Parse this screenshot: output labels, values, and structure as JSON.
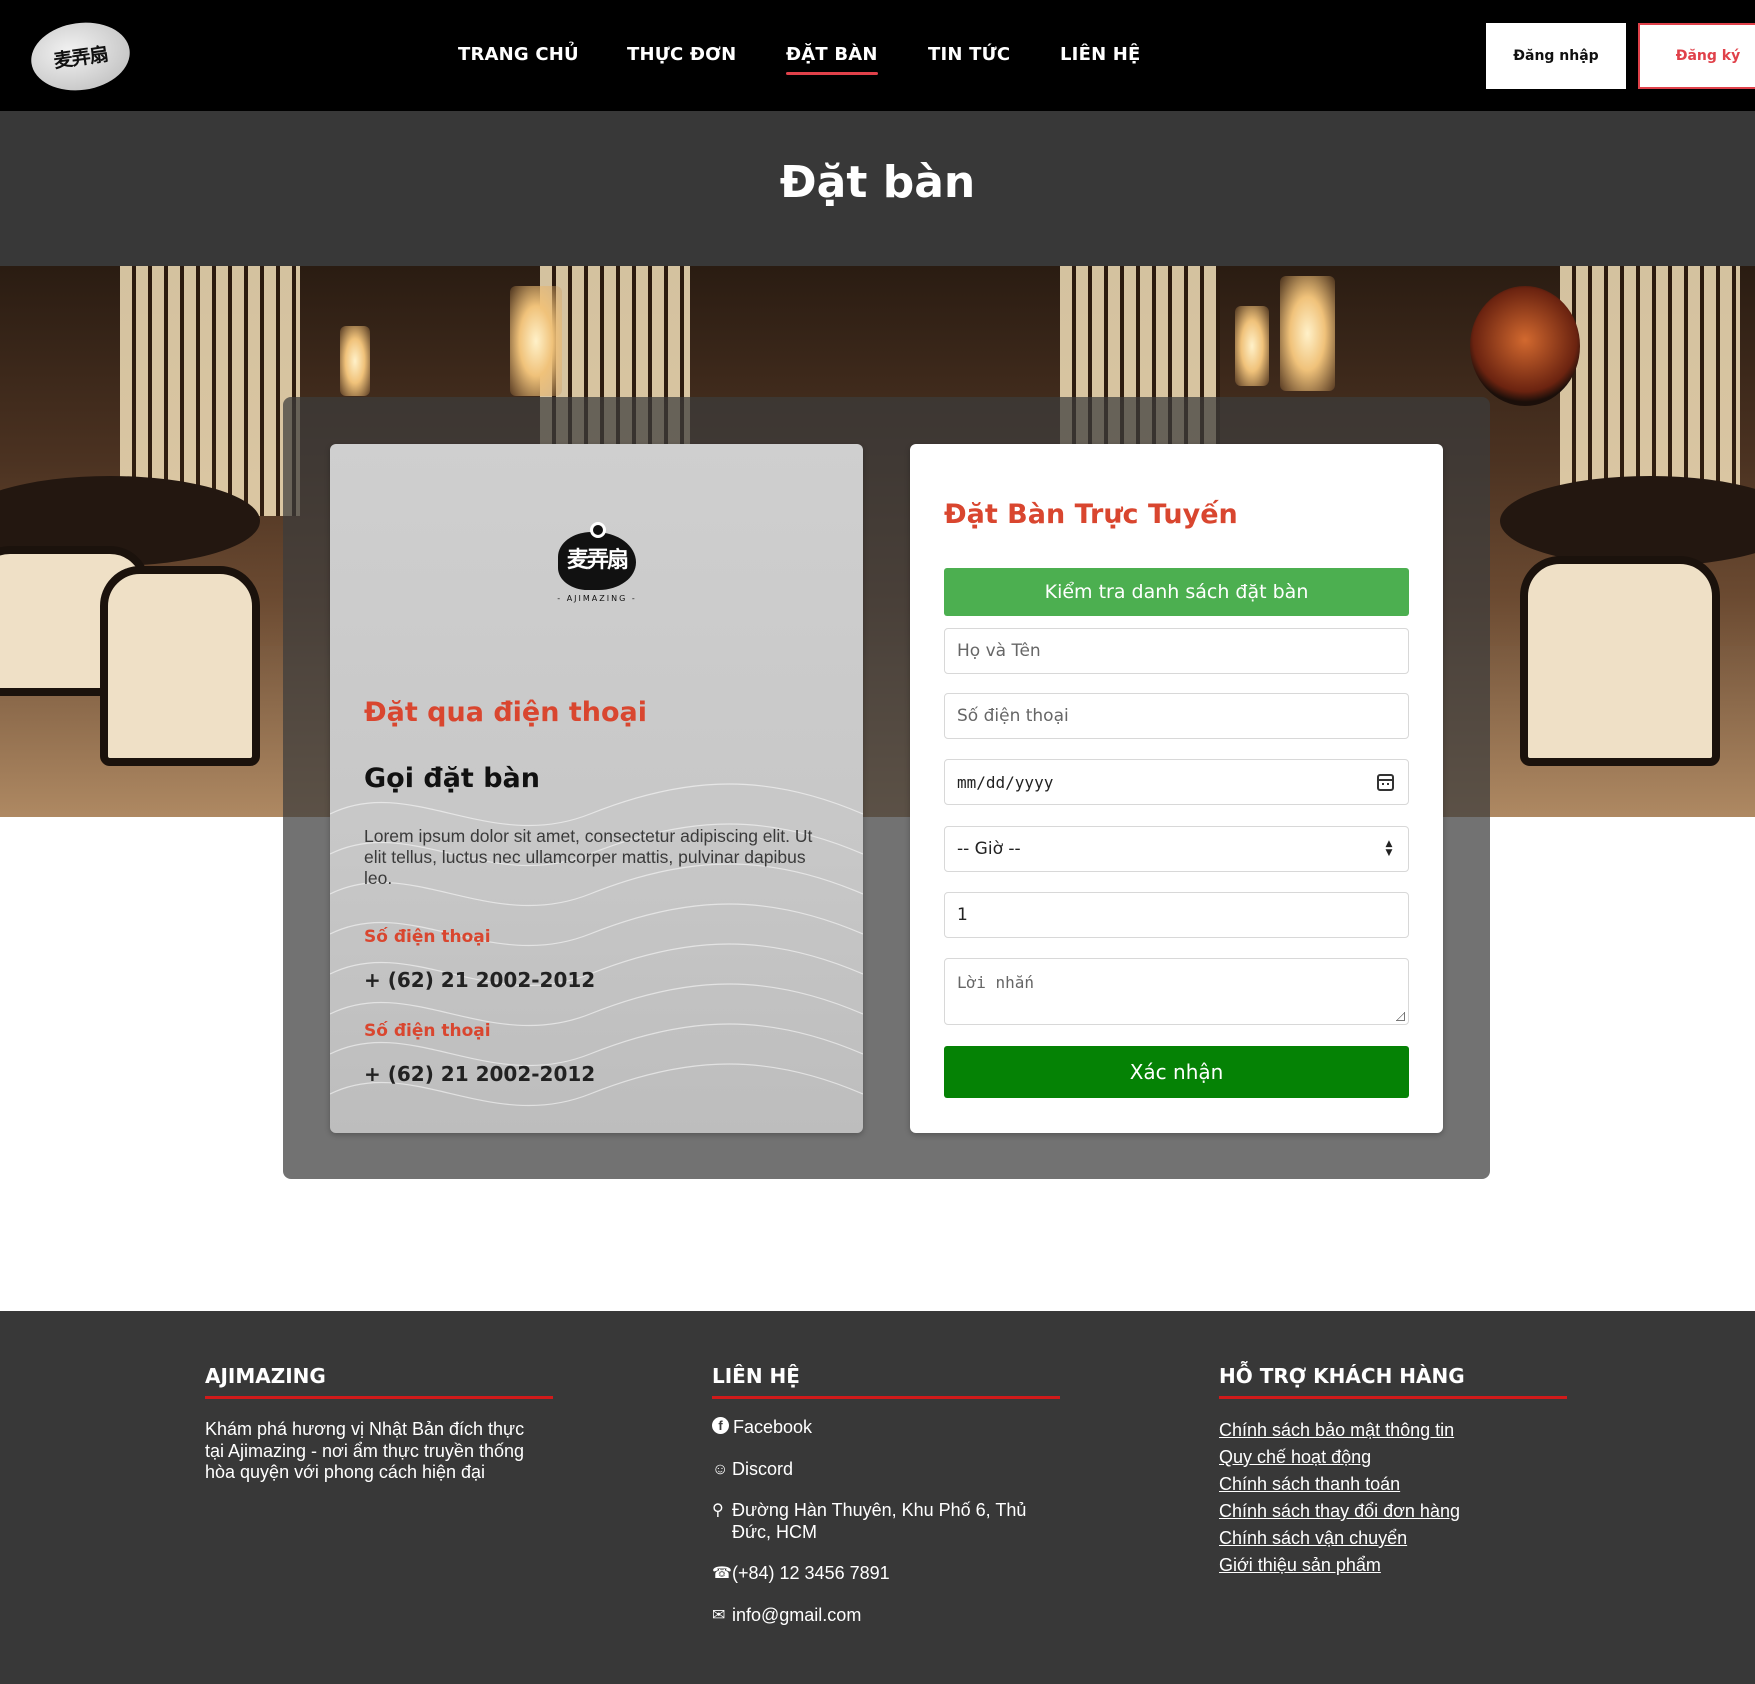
{
  "header": {
    "logo_alt": "Ajimazing",
    "logo_glyph": "麦弄扇",
    "nav": [
      {
        "label": "TRANG CHỦ",
        "active": false
      },
      {
        "label": "THỰC ĐƠN",
        "active": false
      },
      {
        "label": "ĐẶT BÀN",
        "active": true
      },
      {
        "label": "TIN TỨC",
        "active": false
      },
      {
        "label": "LIÊN HỆ",
        "active": false
      }
    ],
    "login_label": "Đăng nhập",
    "register_label": "Đăng ký"
  },
  "page_title": "Đặt bàn",
  "phone_card": {
    "logo_glyph": "麦弄扇",
    "logo_sub": "- AJIMAZING -",
    "heading": "Đặt qua điện thoại",
    "subheading": "Gọi đặt bàn",
    "text": "Lorem ipsum dolor sit amet, consectetur adipiscing elit. Ut elit tellus, luctus nec ullamcorper mattis, pulvinar dapibus leo.",
    "contacts": [
      {
        "label": "Số điện thoại",
        "value": "+ (62) 21 2002-2012"
      },
      {
        "label": "Số điện thoại",
        "value": "+ (62) 21 2002-2012"
      }
    ]
  },
  "booking_form": {
    "heading": "Đặt Bàn Trực Tuyến",
    "check_button": "Kiểm tra danh sách đặt bàn",
    "name_placeholder": "Họ và Tên",
    "phone_placeholder": "Số điện thoại",
    "date_placeholder": "mm/dd/yyyy",
    "time_selected": "-- Giờ --",
    "guests_value": "1",
    "message_placeholder": "Lời nhắn",
    "submit_button": "Xác nhận"
  },
  "footer": {
    "about": {
      "heading": "AJIMAZING",
      "text": "Khám phá hương vị Nhật Bản đích thực tại Ajimazing - nơi ẩm thực truyền thống hòa quyện với phong cách hiện đại"
    },
    "contact": {
      "heading": "LIÊN HỆ",
      "items": [
        {
          "icon": "facebook-icon",
          "text": "Facebook"
        },
        {
          "icon": "discord-icon",
          "text": "Discord"
        },
        {
          "icon": "location-pin-icon",
          "text": "Đường Hàn Thuyên, Khu Phố 6, Thủ Đức, HCM"
        },
        {
          "icon": "phone-icon",
          "text": "(+84) 12 3456 7891"
        },
        {
          "icon": "mail-icon",
          "text": "info@gmail.com"
        }
      ]
    },
    "support": {
      "heading": "HỖ TRỢ KHÁCH HÀNG",
      "links": [
        "Chính sách bảo mật thông tin",
        "Quy chế hoạt động",
        "Chính sách thanh toán",
        "Chính sách thay đổi đơn hàng",
        "Chính sách vận chuyển",
        "Giới thiệu sản phẩm"
      ]
    }
  },
  "colors": {
    "accent_red": "#d9462f",
    "nav_underline": "#e0414a",
    "check_button_green": "#4caf50",
    "submit_button_green": "#058205",
    "footer_underline": "#d11a1a",
    "dark_band": "#383838"
  }
}
